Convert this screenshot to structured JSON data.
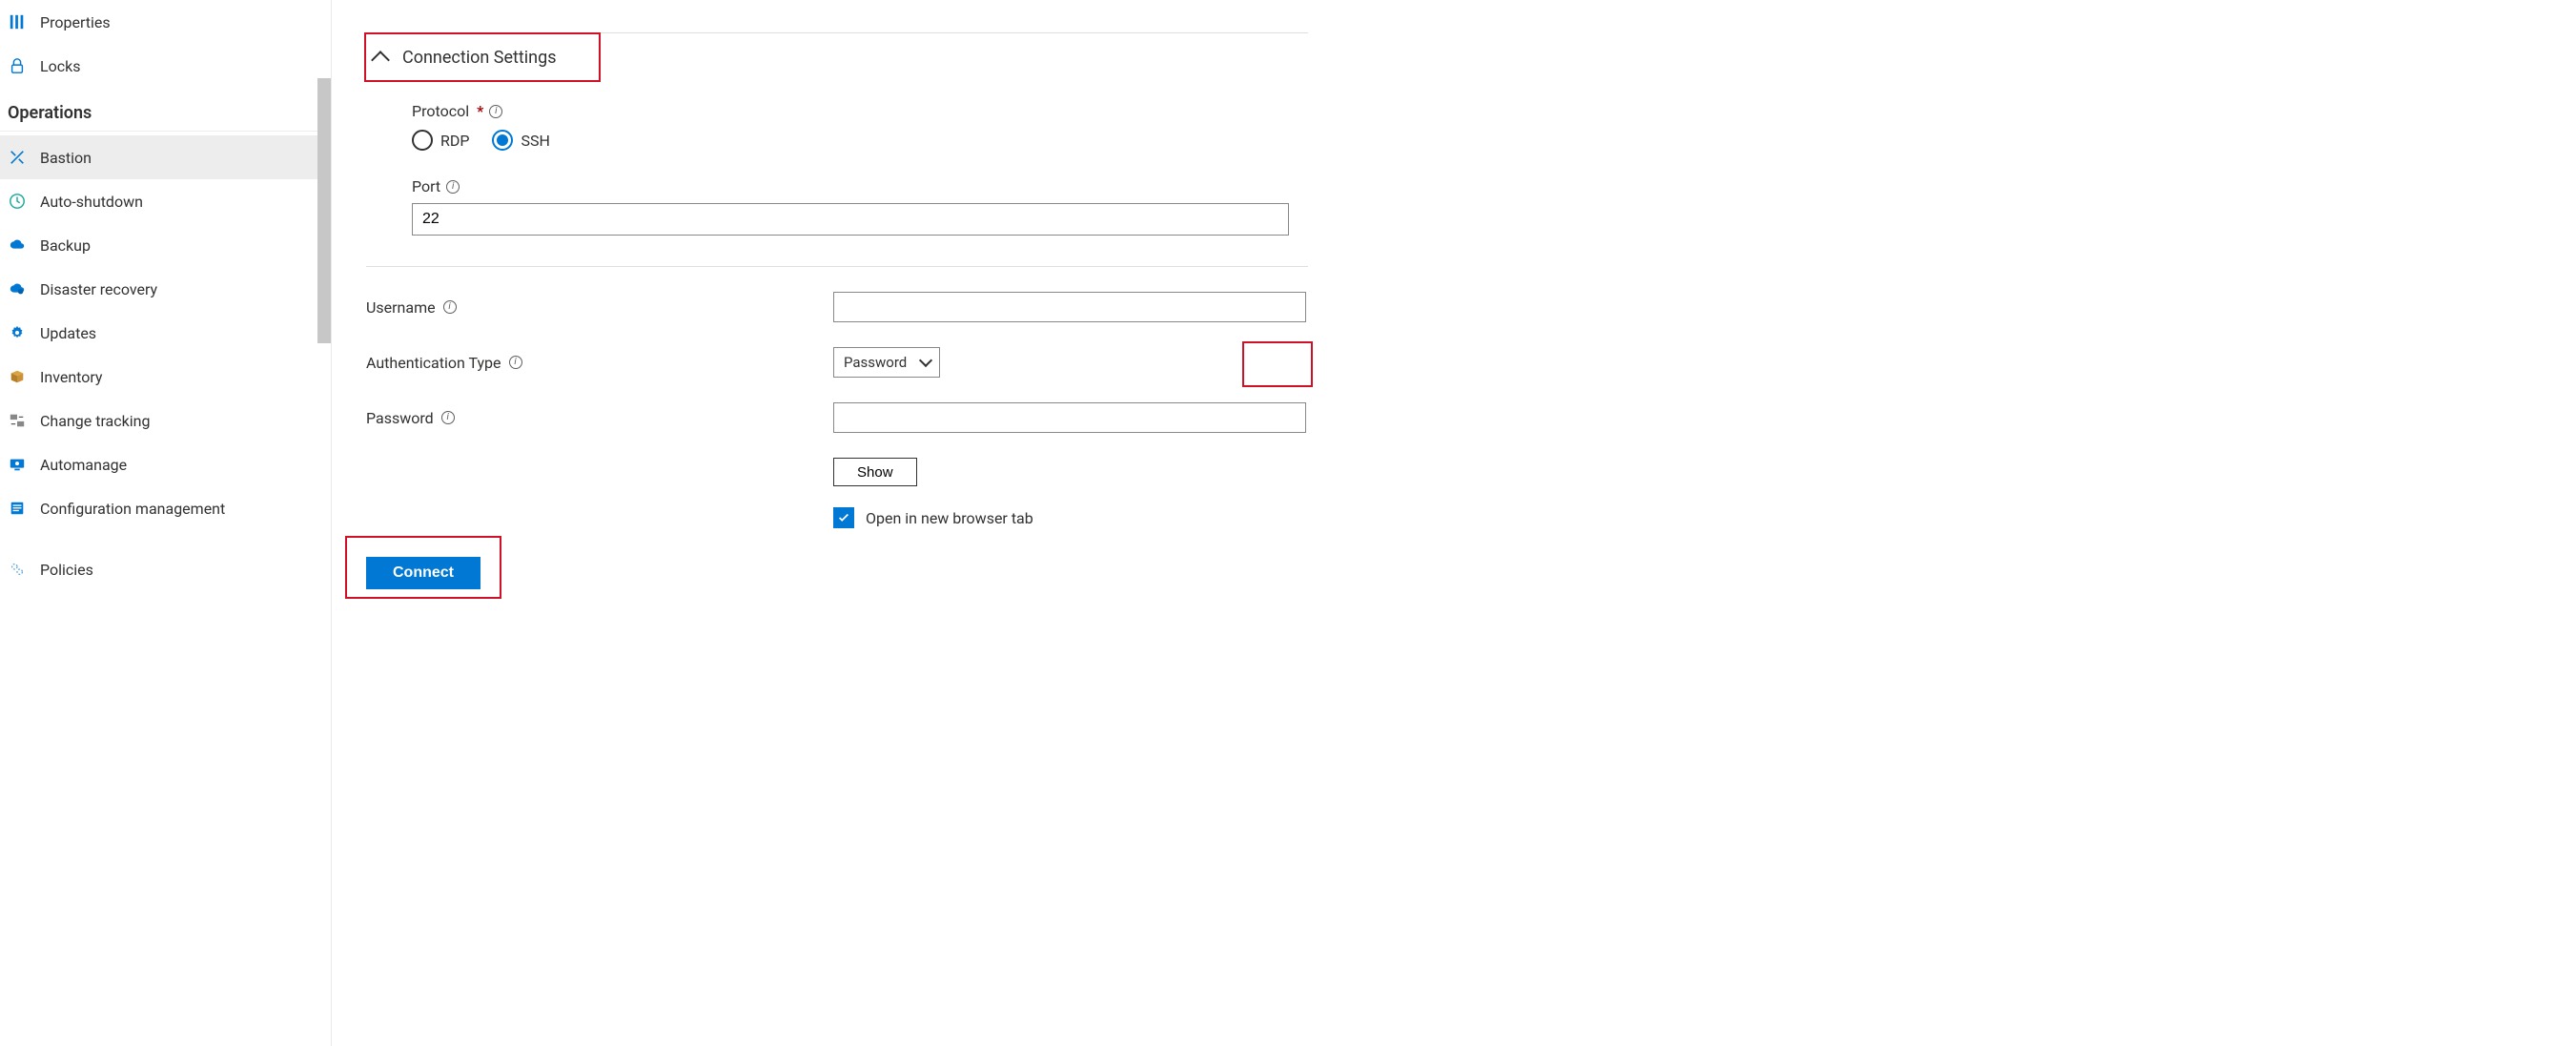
{
  "sidebar": {
    "top_items": [
      {
        "id": "properties",
        "label": "Properties"
      },
      {
        "id": "locks",
        "label": "Locks"
      }
    ],
    "group_label": "Operations",
    "ops_items": [
      {
        "id": "bastion",
        "label": "Bastion",
        "selected": true
      },
      {
        "id": "auto-shutdown",
        "label": "Auto-shutdown"
      },
      {
        "id": "backup",
        "label": "Backup"
      },
      {
        "id": "dr",
        "label": "Disaster recovery"
      },
      {
        "id": "updates",
        "label": "Updates"
      },
      {
        "id": "inventory",
        "label": "Inventory"
      },
      {
        "id": "change-tracking",
        "label": "Change tracking"
      },
      {
        "id": "automanage",
        "label": "Automanage"
      },
      {
        "id": "config-mgmt",
        "label": "Configuration management"
      },
      {
        "id": "policies",
        "label": "Policies"
      }
    ]
  },
  "conn": {
    "section_title": "Connection Settings",
    "protocol_label": "Protocol",
    "protocol_opts": {
      "rdp": "RDP",
      "ssh": "SSH"
    },
    "protocol_value": "ssh",
    "port_label": "Port",
    "port_value": "22",
    "username_label": "Username",
    "username_value": "",
    "authtype_label": "Authentication Type",
    "authtype_value": "Password",
    "password_label": "Password",
    "password_value": "",
    "show_label": "Show",
    "newtab_label": "Open in new browser tab",
    "newtab_checked": true,
    "connect_label": "Connect"
  }
}
